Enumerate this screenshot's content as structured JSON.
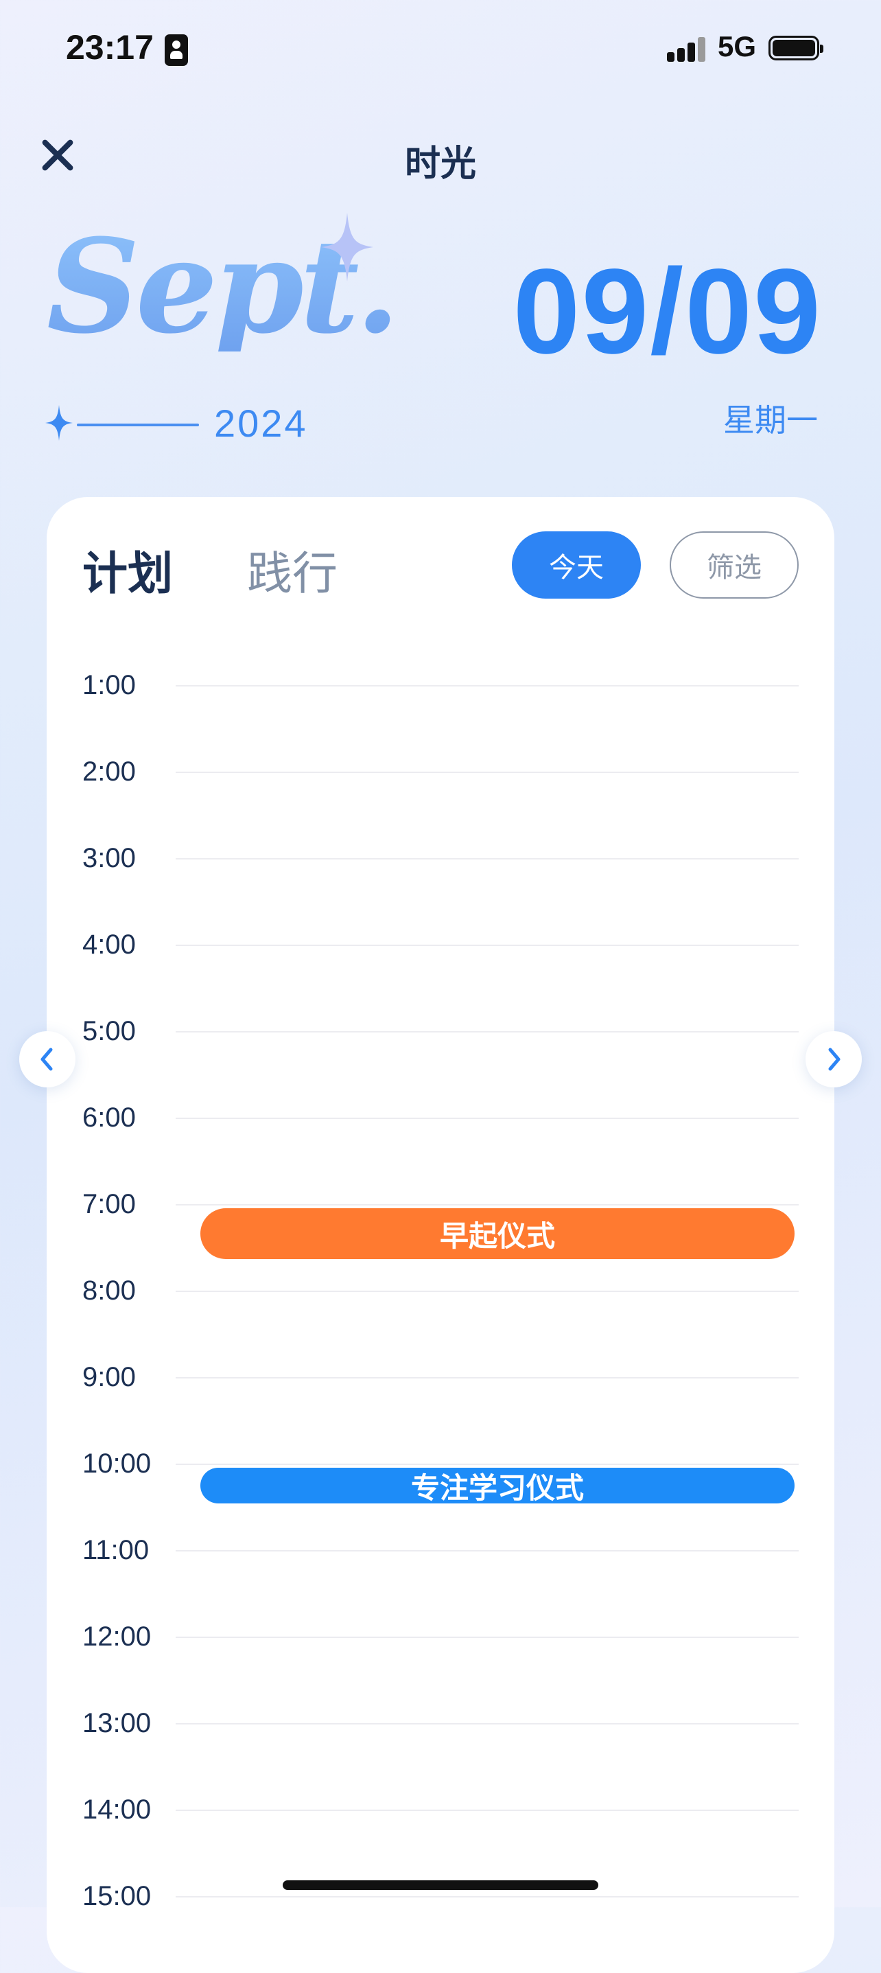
{
  "status_bar": {
    "time": "23:17",
    "network": "5G",
    "icons": [
      "contact-card-icon",
      "signal-icon",
      "battery-icon"
    ]
  },
  "header": {
    "title": "时光",
    "close_icon": "close-icon"
  },
  "hero": {
    "month": "Sept.",
    "year": "2024",
    "date": "09/09",
    "weekday": "星期一",
    "decorations": [
      "sparkle-icon"
    ]
  },
  "tabs": [
    {
      "label": "计划",
      "active": true
    },
    {
      "label": "践行",
      "active": false
    }
  ],
  "buttons": {
    "today": "今天",
    "filter": "筛选"
  },
  "timeline": {
    "hours": [
      "1:00",
      "2:00",
      "3:00",
      "4:00",
      "5:00",
      "6:00",
      "7:00",
      "8:00",
      "9:00",
      "10:00",
      "11:00",
      "12:00",
      "13:00",
      "14:00",
      "15:00"
    ],
    "events": [
      {
        "label": "早起仪式",
        "color": "#ff7a30"
      },
      {
        "label": "专注学习仪式",
        "color": "#1d8cf8"
      }
    ]
  },
  "navigation": {
    "prev_icon": "chevron-left-icon",
    "next_icon": "chevron-right-icon"
  },
  "colors": {
    "accent": "#2d84f4",
    "title": "#1b2f52",
    "muted": "#8190a6"
  }
}
